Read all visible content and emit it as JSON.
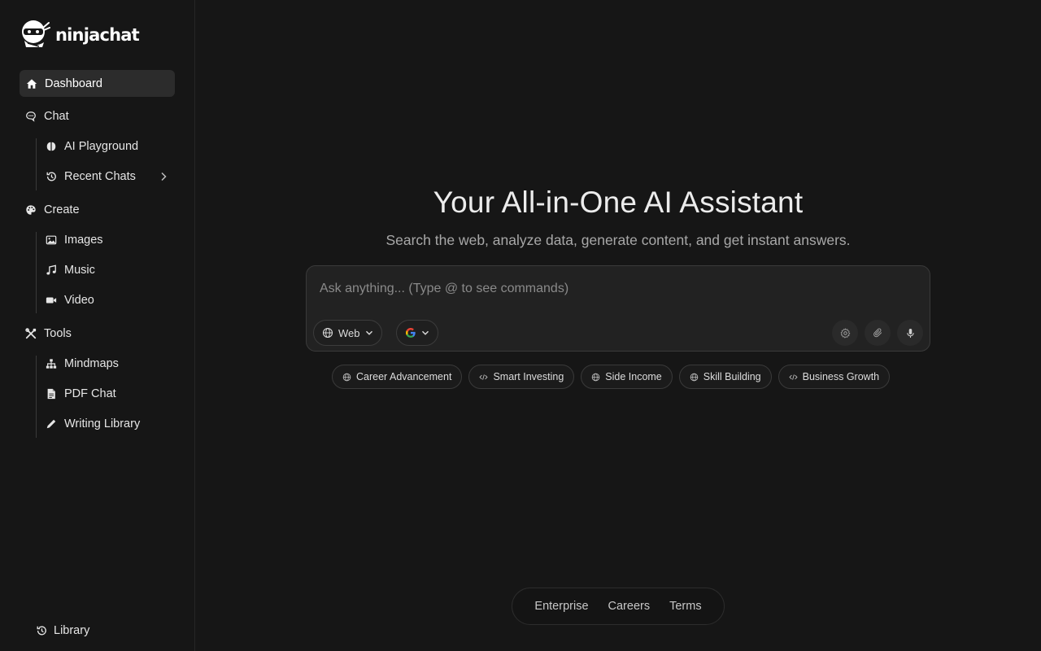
{
  "brand": {
    "name": "ninjachat"
  },
  "sidebar": {
    "dashboard": "Dashboard",
    "chat": {
      "label": "Chat",
      "items": [
        "AI Playground",
        "Recent Chats"
      ]
    },
    "create": {
      "label": "Create",
      "items": [
        "Images",
        "Music",
        "Video"
      ]
    },
    "tools": {
      "label": "Tools",
      "items": [
        "Mindmaps",
        "PDF Chat",
        "Writing Library"
      ]
    },
    "library": "Library"
  },
  "hero": {
    "title": "Your All-in-One AI Assistant",
    "subtitle": "Search the web, analyze data, generate content, and get instant answers."
  },
  "composer": {
    "placeholder": "Ask anything... (Type @ to see commands)",
    "value": "",
    "source_label": "Web",
    "engine_icon": "google-icon"
  },
  "suggestions": [
    {
      "label": "Career Advancement",
      "icon": "globe-icon"
    },
    {
      "label": "Smart Investing",
      "icon": "code-icon"
    },
    {
      "label": "Side Income",
      "icon": "globe-icon"
    },
    {
      "label": "Skill Building",
      "icon": "globe-icon"
    },
    {
      "label": "Business Growth",
      "icon": "code-icon"
    }
  ],
  "footer": {
    "links": [
      "Enterprise",
      "Careers",
      "Terms"
    ]
  },
  "colors": {
    "background": "#161616",
    "active_item": "#2c2c2c",
    "border": "#3a3a3a"
  }
}
